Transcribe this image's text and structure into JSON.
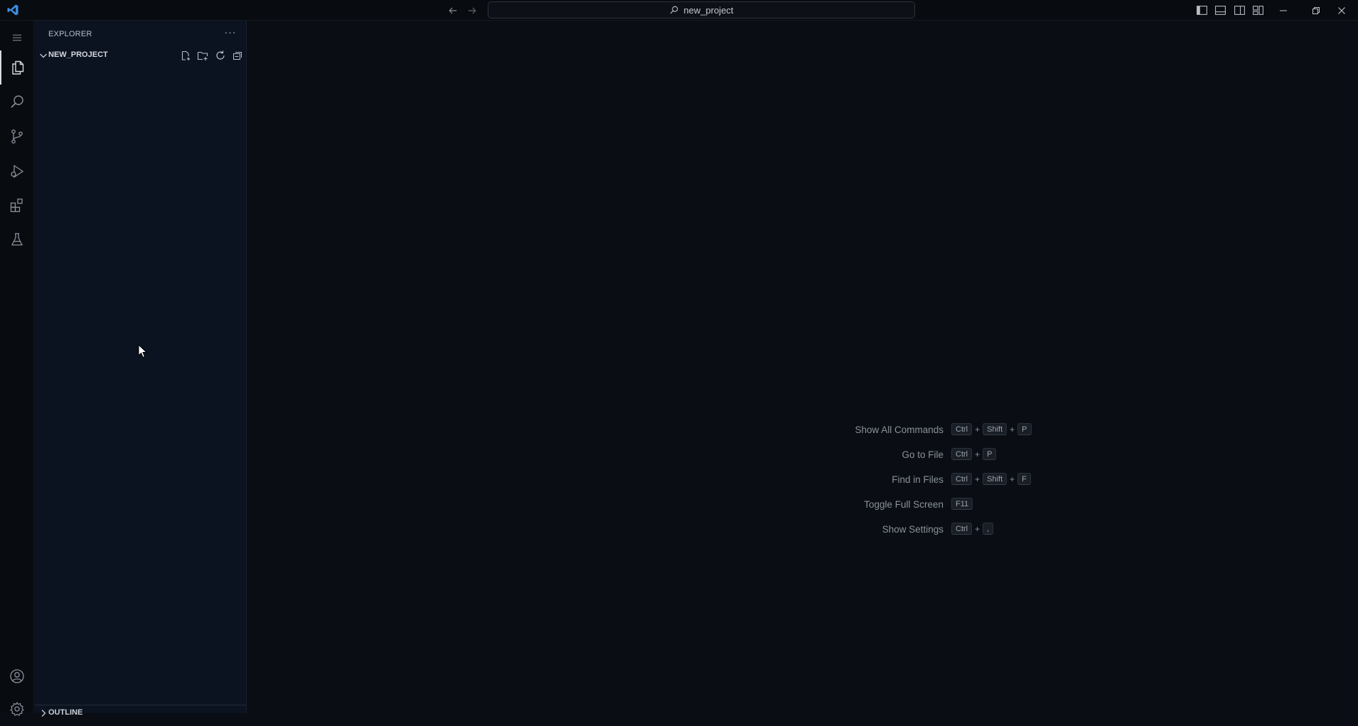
{
  "titlebar": {
    "search_text": "new_project",
    "icons": {
      "logo": "vscode-logo-icon",
      "back": "arrow-left-icon",
      "forward": "arrow-right-icon",
      "search": "search-icon",
      "toggle_primary_sidebar": "layout-sidebar-left-icon",
      "toggle_panel": "layout-panel-icon",
      "toggle_secondary_sidebar": "layout-sidebar-right-icon",
      "customize_layout": "layout-customize-icon",
      "minimize": "minimize-icon",
      "restore": "restore-icon",
      "close": "close-icon"
    }
  },
  "activitybar": {
    "items": [
      {
        "name": "explorer",
        "icon": "files-icon",
        "active": true
      },
      {
        "name": "search",
        "icon": "search-icon",
        "active": false
      },
      {
        "name": "source-control",
        "icon": "source-control-icon",
        "active": false
      },
      {
        "name": "run-and-debug",
        "icon": "run-debug-icon",
        "active": false
      },
      {
        "name": "extensions",
        "icon": "extensions-icon",
        "active": false
      },
      {
        "name": "testing",
        "icon": "beaker-icon",
        "active": false
      }
    ],
    "bottom": [
      {
        "name": "accounts",
        "icon": "account-icon"
      },
      {
        "name": "manage",
        "icon": "gear-icon"
      }
    ]
  },
  "sidebar": {
    "title": "EXPLORER",
    "more_label": "···",
    "folder": {
      "name": "NEW_PROJECT",
      "actions": [
        "new-file-icon",
        "new-folder-icon",
        "refresh-icon",
        "collapse-all-icon"
      ]
    },
    "outline_label": "OUTLINE"
  },
  "editor": {
    "shortcuts": [
      {
        "label": "Show All Commands",
        "keys": [
          "Ctrl",
          "Shift",
          "P"
        ]
      },
      {
        "label": "Go to File",
        "keys": [
          "Ctrl",
          "P"
        ]
      },
      {
        "label": "Find in Files",
        "keys": [
          "Ctrl",
          "Shift",
          "F"
        ]
      },
      {
        "label": "Toggle Full Screen",
        "keys": [
          "F11"
        ]
      },
      {
        "label": "Show Settings",
        "keys": [
          "Ctrl",
          ","
        ]
      }
    ]
  },
  "colors": {
    "background": "#0a0e14",
    "sidebar": "#0c1320",
    "accent": "#3c8fe0"
  }
}
